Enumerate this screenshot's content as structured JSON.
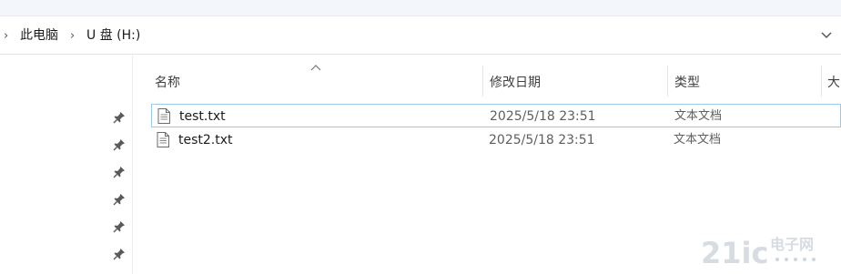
{
  "breadcrumb": {
    "items": [
      "此电脑",
      "U 盘 (H:)"
    ]
  },
  "columns": {
    "name": "名称",
    "date": "修改日期",
    "type": "类型",
    "size": "大"
  },
  "files": [
    {
      "name": "test.txt",
      "date": "2025/5/18 23:51",
      "type": "文本文档",
      "selected": true
    },
    {
      "name": "test2.txt",
      "date": "2025/5/18 23:51",
      "type": "文本文档",
      "selected": false
    }
  ],
  "quick_access": {
    "pinned_count": 6
  },
  "watermark": {
    "text_main": "21ic",
    "text_cn": "电子网"
  },
  "icons": {
    "breadcrumb_sep": "chevron-right-icon",
    "expand": "chevron-down-icon",
    "pin": "pin-icon",
    "file": "text-file-icon",
    "sort": "sort-ascending-icon"
  },
  "colors": {
    "selection_border": "#9ccaea",
    "header_text": "#404040",
    "secondary_text": "#5f5f5f"
  }
}
